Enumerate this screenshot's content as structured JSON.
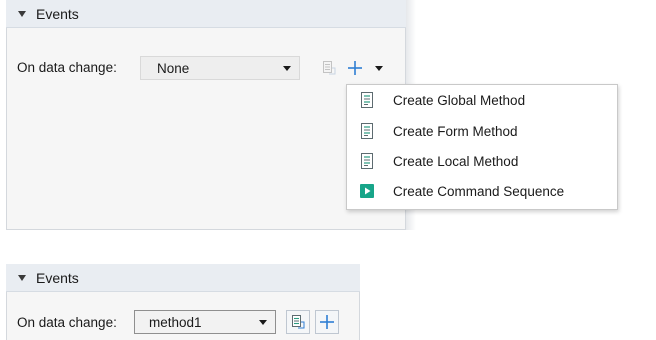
{
  "top_panel": {
    "section_title": "Events",
    "field_label": "On data change:",
    "combo_value": "None",
    "menu": {
      "items": [
        {
          "label": "Create Global Method",
          "icon": "method-document-icon"
        },
        {
          "label": "Create Form Method",
          "icon": "method-document-icon"
        },
        {
          "label": "Create Local Method",
          "icon": "method-document-icon"
        },
        {
          "label": "Create Command Sequence",
          "icon": "command-sequence-play-icon"
        }
      ]
    }
  },
  "bottom_panel": {
    "section_title": "Events",
    "field_label": "On data change:",
    "combo_value": "method1"
  },
  "colors": {
    "header_bg": "#e9edf2",
    "panel_bg": "#f6f6f6",
    "accent_blue": "#2f7fd4",
    "command_green": "#17a589"
  }
}
